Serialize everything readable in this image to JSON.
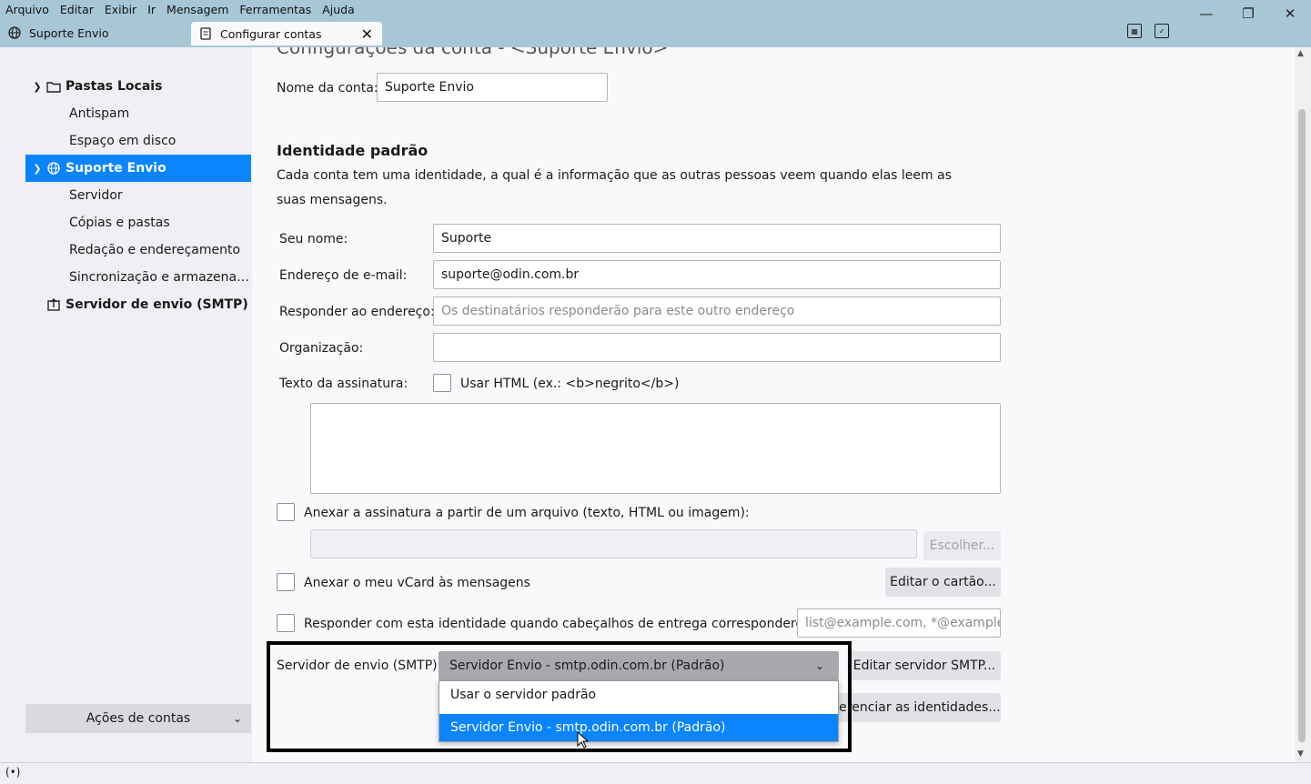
{
  "menu": [
    "Arquivo",
    "Editar",
    "Exibir",
    "Ir",
    "Mensagem",
    "Ferramentas",
    "Ajuda"
  ],
  "tabs": [
    {
      "label": "Suporte Envio"
    },
    {
      "label": "Configurar contas"
    }
  ],
  "sidebar": {
    "items": [
      {
        "label": "Pastas Locais"
      },
      {
        "label": "Antispam"
      },
      {
        "label": "Espaço em disco"
      },
      {
        "label": "Suporte Envio"
      },
      {
        "label": "Servidor"
      },
      {
        "label": "Cópias e pastas"
      },
      {
        "label": "Redação e endereçamento"
      },
      {
        "label": "Sincronização e armazenam..."
      },
      {
        "label": "Servidor de envio (SMTP)"
      }
    ],
    "account_actions": "Ações de contas"
  },
  "main": {
    "title": "Configurações da conta - <Suporte Envio>",
    "account_name_label": "Nome da conta:",
    "account_name_value": "Suporte Envio",
    "identity_heading": "Identidade padrão",
    "identity_desc": "Cada conta tem uma identidade, a qual é a informação que as outras pessoas veem quando elas leem as suas mensagens.",
    "name_label": "Seu nome:",
    "name_value": "Suporte",
    "email_label": "Endereço de e-mail:",
    "email_value": "suporte@odin.com.br",
    "reply_label": "Responder ao endereço:",
    "reply_placeholder": "Os destinatários responderão para este outro endereço",
    "org_label": "Organização:",
    "org_value": "",
    "signature_label": "Texto da assinatura:",
    "use_html_label": "Usar HTML (ex.: <b>negrito</b>)",
    "attach_sig_label": "Anexar a assinatura a partir de um arquivo (texto, HTML ou imagem):",
    "choose_button": "Escolher...",
    "attach_vcard_label": "Anexar o meu vCard às mensagens",
    "edit_card_button": "Editar o cartão...",
    "reply_identity_label": "Responder com esta identidade quando cabeçalhos de entrega corresponderem:",
    "reply_identity_placeholder": "list@example.com, *@example",
    "smtp_label": "Servidor de envio (SMTP):",
    "smtp_selected": "Servidor Envio - smtp.odin.com.br (Padrão)",
    "smtp_options": [
      "Usar o servidor padrão",
      "Servidor Envio - smtp.odin.com.br (Padrão)"
    ],
    "edit_smtp_button": "Editar servidor SMTP...",
    "manage_identities_button": "Gerenciar as identidades..."
  }
}
